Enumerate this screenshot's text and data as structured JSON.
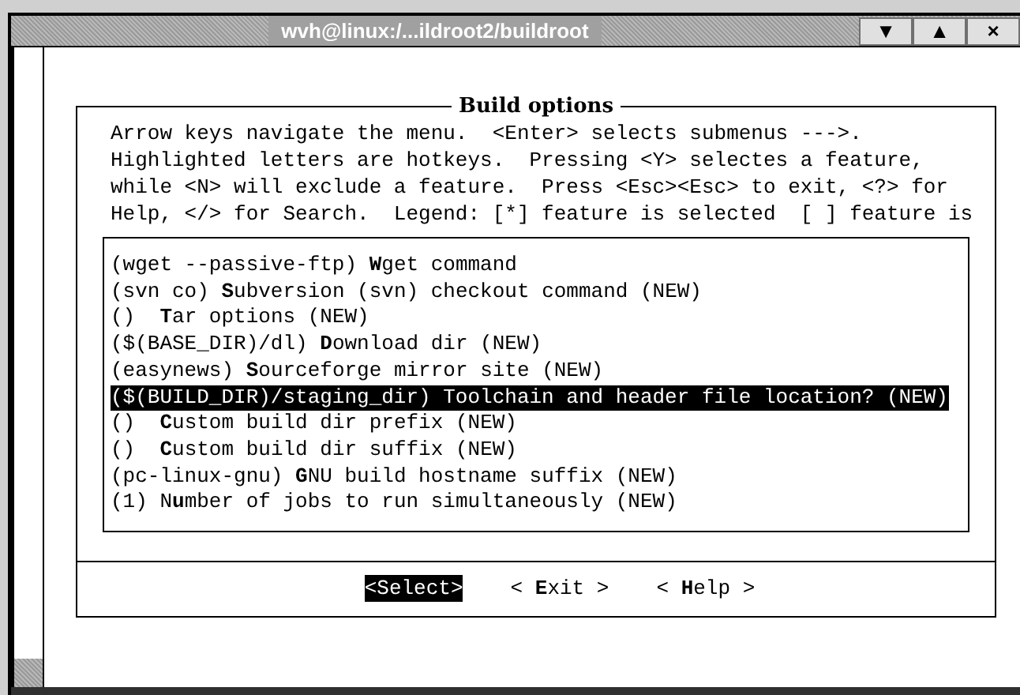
{
  "window": {
    "title": "wvh@linux:/...ildroot2/buildroot",
    "buttons": [
      "▼",
      "▲",
      "×"
    ]
  },
  "dialog": {
    "title": "Build options",
    "help_lines": [
      "Arrow keys navigate the menu.  <Enter> selects submenus --->.",
      "Highlighted letters are hotkeys.  Pressing <Y> selectes a feature,",
      "while <N> will exclude a feature.  Press <Esc><Esc> to exit, <?> for",
      "Help, </> for Search.  Legend: [*] feature is selected  [ ] feature is"
    ],
    "items": [
      {
        "text": "(wget --passive-ftp) **W**get command",
        "selected": false
      },
      {
        "text": "(svn co) **S**ubversion (svn) checkout command (NEW)",
        "selected": false
      },
      {
        "text": "()  **T**ar options (NEW)",
        "selected": false
      },
      {
        "text": "($(BASE_DIR)/dl) **D**ownload dir (NEW)",
        "selected": false
      },
      {
        "text": "(easynews) **S**ourceforge mirror site (NEW)",
        "selected": false
      },
      {
        "text": "($(BUILD_DIR)/staging_dir) Toolchain and header file location? (NEW)",
        "selected": true
      },
      {
        "text": "()  **C**ustom build dir prefix (NEW)",
        "selected": false
      },
      {
        "text": "()  **C**ustom build dir suffix (NEW)",
        "selected": false
      },
      {
        "text": "(pc-linux-gnu) **G**NU build hostname suffix (NEW)",
        "selected": false
      },
      {
        "text": "(1) N**u**mber of jobs to run simultaneously (NEW)",
        "selected": false
      }
    ],
    "buttons": [
      {
        "label": "<Select>",
        "selected": true
      },
      {
        "label": "< **E**xit >",
        "selected": false
      },
      {
        "label": "< **H**elp >",
        "selected": false
      }
    ]
  }
}
